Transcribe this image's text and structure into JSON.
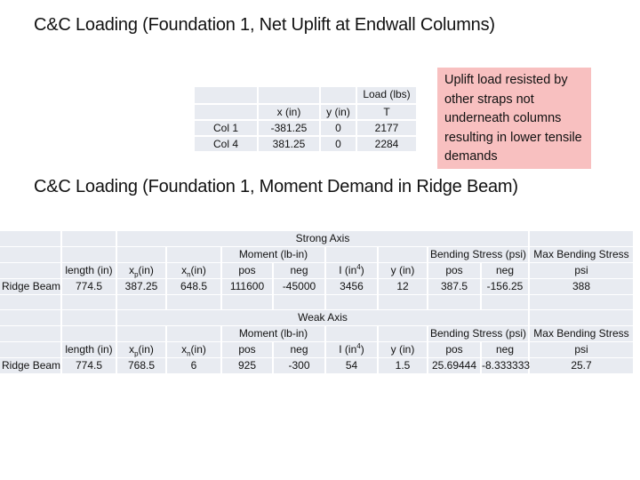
{
  "slide": {
    "title_uplift": "C&C Loading (Foundation 1, Net Uplift at Endwall Columns)",
    "title_moment": "C&C Loading (Foundation 1, Moment Demand in Ridge Beam)"
  },
  "note": {
    "text": "Uplift load resisted by other straps not underneath columns resulting in lower tensile demands",
    "background_color": "#f8c0c0"
  },
  "uplift_table": {
    "header_top": {
      "load": "Load (lbs)"
    },
    "headers": {
      "x": "x (in)",
      "y": "y (in)",
      "t": "T"
    },
    "rows": [
      {
        "label": "Col 1",
        "x": "-381.25",
        "y": "0",
        "t": "2177"
      },
      {
        "label": "Col 4",
        "x": "381.25",
        "y": "0",
        "t": "2284"
      }
    ]
  },
  "ridge_tables": [
    {
      "axis_title": "Strong Axis",
      "moment_header": "Moment (lb-in)",
      "stress_header": "Bending Stress (psi)",
      "max_stress_header": "Max Bending Stress",
      "headers": {
        "length": "length (in)",
        "xp_base": "x",
        "xp_sub": "p",
        "xp_unit": "(in)",
        "xn_base": "x",
        "xn_sub": "n",
        "xn_unit": "(in)",
        "pos": "pos",
        "neg": "neg",
        "i_base": "I (in",
        "i_sup": "4",
        "i_close": ")",
        "y": "y (in)",
        "stress_pos": "pos",
        "stress_neg": "neg",
        "max_unit": "psi"
      },
      "row": {
        "label": "Ridge Beam",
        "length": "774.5",
        "xp": "387.25",
        "xn": "648.5",
        "moment_pos": "111600",
        "moment_neg": "-45000",
        "i": "3456",
        "y": "12",
        "stress_pos": "387.5",
        "stress_neg": "-156.25",
        "max_stress": "388"
      }
    },
    {
      "axis_title": "Weak Axis",
      "moment_header": "Moment (lb-in)",
      "stress_header": "Bending Stress (psi)",
      "max_stress_header": "Max Bending Stress",
      "headers": {
        "length": "length (in)",
        "xp_base": "x",
        "xp_sub": "p",
        "xp_unit": "(in)",
        "xn_base": "x",
        "xn_sub": "n",
        "xn_unit": "(in)",
        "pos": "pos",
        "neg": "neg",
        "i_base": "I (in",
        "i_sup": "4",
        "i_close": ")",
        "y": "y (in)",
        "stress_pos": "pos",
        "stress_neg": "neg",
        "max_unit": "psi"
      },
      "row": {
        "label": "Ridge Beam",
        "length": "774.5",
        "xp": "768.5",
        "xn": "6",
        "moment_pos": "925",
        "moment_neg": "-300",
        "i": "54",
        "y": "1.5",
        "stress_pos": "25.69444",
        "stress_neg": "-8.333333",
        "max_stress": "25.7"
      }
    }
  ],
  "colors": {
    "cell_background": "#e8ebf1",
    "note_background": "#f8c0c0"
  }
}
